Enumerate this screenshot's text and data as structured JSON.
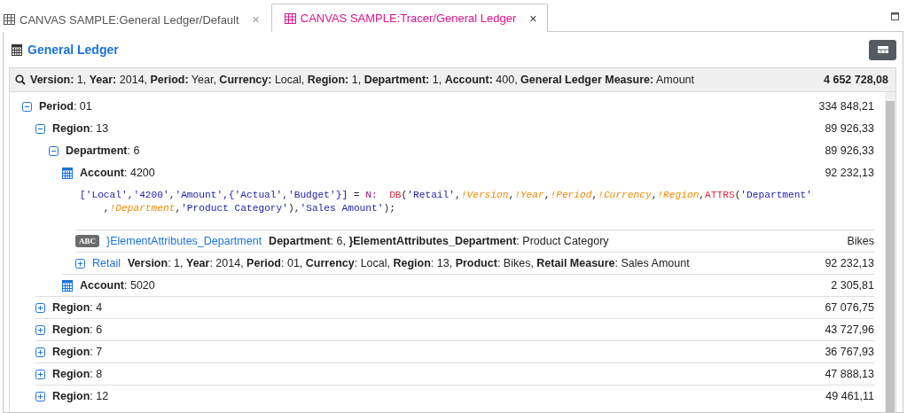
{
  "tabs": [
    {
      "label": "CANVAS SAMPLE:General Ledger/Default",
      "selected": false,
      "close": "×"
    },
    {
      "label": "CANVAS SAMPLE:Tracer/General Ledger",
      "selected": true,
      "close": "×"
    }
  ],
  "title": "General Ledger",
  "query": {
    "text": "**Version:** 1, **Year:** 2014, **Period:** Year, **Currency:** Local, **Region:** 1, **Department:** 1, **Account:** 400, **General Ledger Measure:** Amount",
    "value": "4 652 728,08"
  },
  "tree": [
    {
      "kind": "dimension",
      "label": "**Period**: 01",
      "value": "334 848,21",
      "expanded": true,
      "children": [
        {
          "kind": "dimension",
          "label": "**Region**: 13",
          "value": "89 926,33",
          "expanded": true,
          "children": [
            {
              "kind": "dimension",
              "label": "**Department**: 6",
              "value": "89 926,33",
              "expanded": true,
              "children": [
                {
                  "kind": "account",
                  "label": "**Account**: 4200",
                  "value": "92 232,13",
                  "formula": [
                    [
                      {
                        "kind": "string",
                        "text": "['Local','4200','Amount',{'Actual','Budget'}]"
                      },
                      {
                        "kind": "plain",
                        "text": " = "
                      },
                      {
                        "kind": "keyword",
                        "text": "N:  "
                      },
                      {
                        "kind": "function",
                        "text": "DB"
                      },
                      {
                        "kind": "plain",
                        "text": "("
                      },
                      {
                        "kind": "string",
                        "text": "'Retail'"
                      },
                      {
                        "kind": "plain",
                        "text": ","
                      },
                      {
                        "kind": "variable",
                        "text": "!Version"
                      },
                      {
                        "kind": "plain",
                        "text": ","
                      },
                      {
                        "kind": "variable",
                        "text": "!Year"
                      },
                      {
                        "kind": "plain",
                        "text": ","
                      },
                      {
                        "kind": "variable",
                        "text": "!Period"
                      },
                      {
                        "kind": "plain",
                        "text": ","
                      },
                      {
                        "kind": "variable",
                        "text": "!Currency"
                      },
                      {
                        "kind": "plain",
                        "text": ","
                      },
                      {
                        "kind": "variable",
                        "text": "!Region"
                      },
                      {
                        "kind": "plain",
                        "text": ","
                      },
                      {
                        "kind": "function",
                        "text": "ATTRS"
                      },
                      {
                        "kind": "plain",
                        "text": "("
                      },
                      {
                        "kind": "string",
                        "text": "'Department'"
                      }
                    ],
                    [
                      {
                        "kind": "plain",
                        "text": "    ,"
                      },
                      {
                        "kind": "variable",
                        "text": "!Department"
                      },
                      {
                        "kind": "plain",
                        "text": ","
                      },
                      {
                        "kind": "string",
                        "text": "'Product Category'"
                      },
                      {
                        "kind": "plain",
                        "text": "),"
                      },
                      {
                        "kind": "string",
                        "text": "'Sales Amount'"
                      },
                      {
                        "kind": "plain",
                        "text": ");"
                      }
                    ]
                  ],
                  "children": [
                    {
                      "kind": "attribute",
                      "badge": "ABC",
                      "link": "}ElementAttributes_Department",
                      "label": "**Department**: 6, **}ElementAttributes_Department**: Product Category",
                      "value": "Bikes"
                    },
                    {
                      "kind": "cube",
                      "link": "Retail",
                      "label": "**Version**: 1, **Year**: 2014, **Period**: 01, **Currency**: Local, **Region**: 13, **Product**: Bikes, **Retail Measure**: Sales Amount",
                      "value": "92 232,13",
                      "expanded": false
                    }
                  ]
                },
                {
                  "kind": "account",
                  "label": "**Account**: 5020",
                  "value": "2 305,81"
                }
              ]
            }
          ]
        },
        {
          "kind": "dimension",
          "label": "**Region**: 4",
          "value": "67 076,75",
          "expanded": false
        },
        {
          "kind": "dimension",
          "label": "**Region**: 6",
          "value": "43 727,96",
          "expanded": false
        },
        {
          "kind": "dimension",
          "label": "**Region**: 7",
          "value": "36 767,93",
          "expanded": false
        },
        {
          "kind": "dimension",
          "label": "**Region**: 8",
          "value": "47 888,13",
          "expanded": false
        },
        {
          "kind": "dimension",
          "label": "**Region**: 12",
          "value": "49 461,11",
          "expanded": false
        }
      ]
    }
  ]
}
